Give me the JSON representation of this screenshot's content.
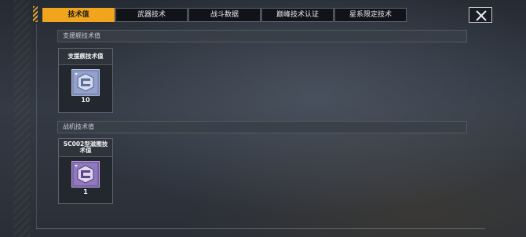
{
  "tabs": [
    {
      "label": "技术值",
      "active": true
    },
    {
      "label": "武器技术",
      "active": false
    },
    {
      "label": "战斗数据",
      "active": false
    },
    {
      "label": "巅峰技术认证",
      "active": false
    },
    {
      "label": "星系限定技术",
      "active": false
    }
  ],
  "sections": [
    {
      "title": "支援舰技术值",
      "cards": [
        {
          "title": "支援舰技术值",
          "count": "10",
          "icon": "support-ship-tech-icon",
          "color": "#8d9cc4"
        }
      ]
    },
    {
      "title": "战机技术值",
      "cards": [
        {
          "title": "SC002型滋图技术值",
          "count": "1",
          "icon": "fighter-tech-icon",
          "color": "#8a73b3"
        }
      ]
    }
  ],
  "colors": {
    "accent": "#f0a51d"
  },
  "close_icon": "close-icon"
}
